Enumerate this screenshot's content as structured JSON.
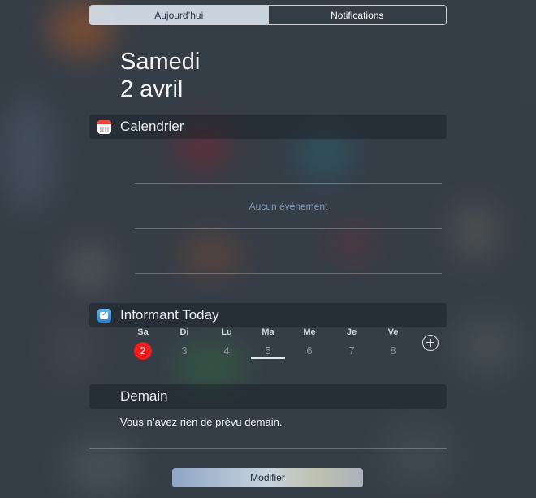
{
  "tabs": {
    "today": "Aujourd’hui",
    "notifications": "Notifications"
  },
  "date": {
    "weekday": "Samedi",
    "day": "2 avril"
  },
  "calendar_widget": {
    "title": "Calendrier",
    "empty_text": "Aucun événement"
  },
  "informant_widget": {
    "title": "Informant Today",
    "days": [
      {
        "name": "Sa",
        "number": "2"
      },
      {
        "name": "Di",
        "number": "3"
      },
      {
        "name": "Lu",
        "number": "4"
      },
      {
        "name": "Ma",
        "number": "5"
      },
      {
        "name": "Me",
        "number": "6"
      },
      {
        "name": "Je",
        "number": "7"
      },
      {
        "name": "Ve",
        "number": "8"
      }
    ],
    "add_icon": "plus-circle-icon"
  },
  "tomorrow_widget": {
    "title": "Demain",
    "message": "Vous n’avez rien de prévu demain."
  },
  "footer": {
    "modify_label": "Modifier"
  },
  "colors": {
    "selected_day": "#ef1d1d",
    "segment_active": "#d7e1ec"
  }
}
